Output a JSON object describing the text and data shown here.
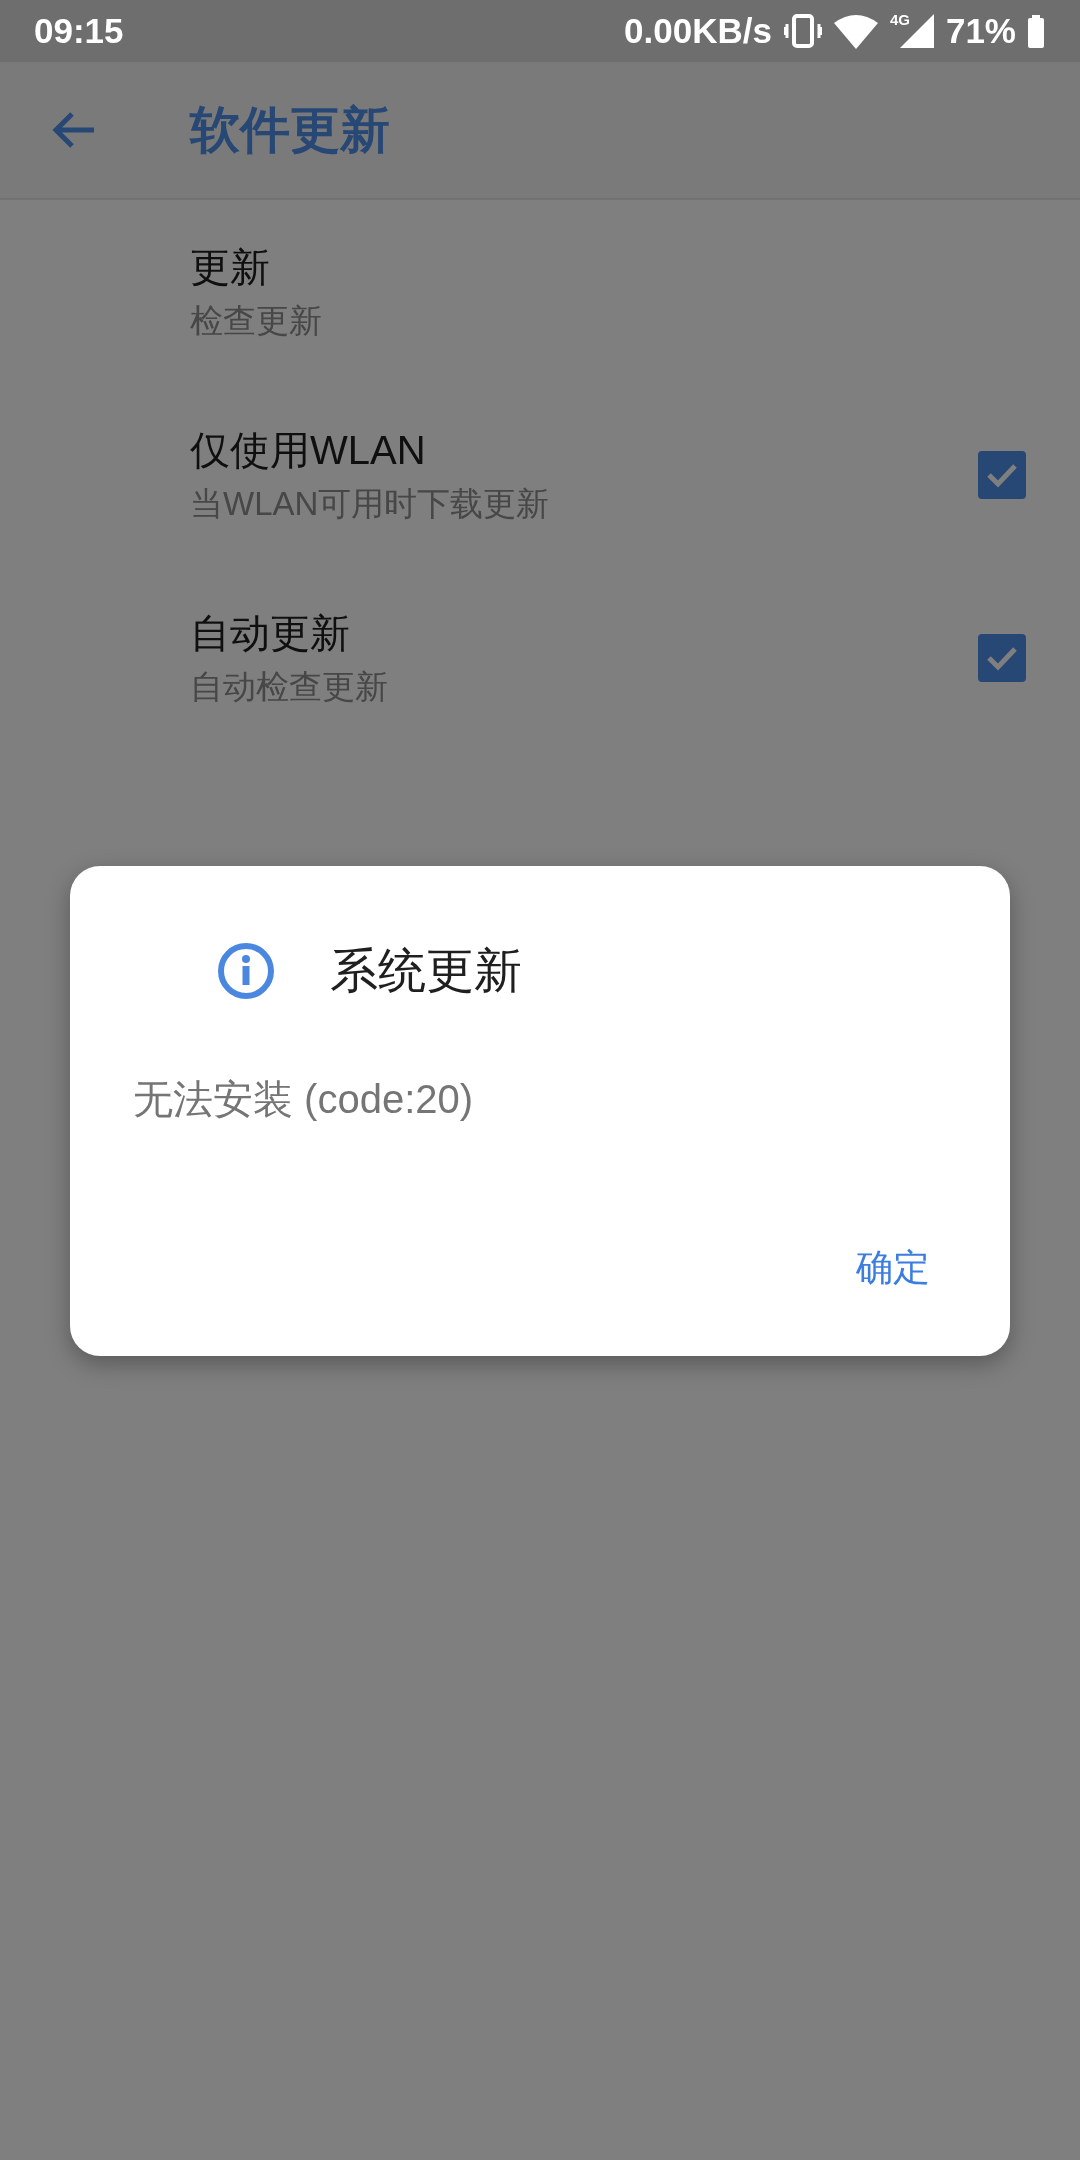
{
  "status_bar": {
    "time": "09:15",
    "net_speed": "0.00KB/s",
    "network_type": "4G",
    "battery": "71%"
  },
  "app_bar": {
    "title": "软件更新"
  },
  "settings": [
    {
      "kind": "text",
      "title": "更新",
      "summary": "检查更新"
    },
    {
      "kind": "checkbox",
      "title": "仅使用WLAN",
      "summary": "当WLAN可用时下载更新",
      "checked": true
    },
    {
      "kind": "checkbox",
      "title": "自动更新",
      "summary": "自动检查更新",
      "checked": true
    }
  ],
  "dialog": {
    "title": "系统更新",
    "message": "无法安装 (code:20)",
    "buttons": [
      "确定"
    ]
  }
}
